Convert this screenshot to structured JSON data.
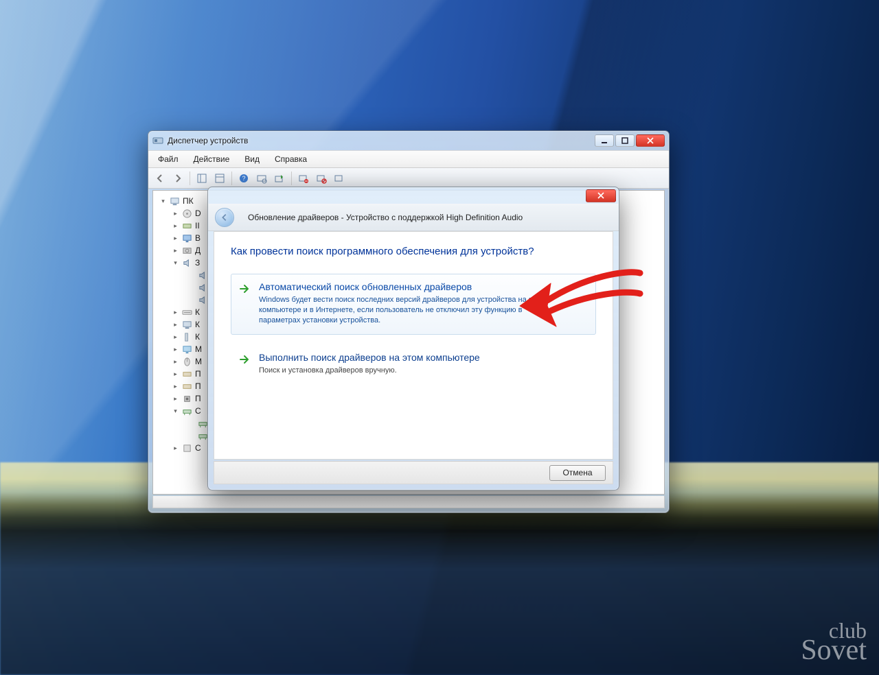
{
  "watermark": {
    "line1": "club",
    "line2": "Sovet"
  },
  "devmgr": {
    "title": "Диспетчер устройств",
    "menu": {
      "file": "Файл",
      "action": "Действие",
      "view": "Вид",
      "help": "Справка"
    },
    "root": "ПК",
    "items": [
      {
        "label": "D",
        "kind": "dvd"
      },
      {
        "label": "II",
        "kind": "ide"
      },
      {
        "label": "В",
        "kind": "display"
      },
      {
        "label": "Д",
        "kind": "disk"
      },
      {
        "label": "З",
        "kind": "sound",
        "expanded": true,
        "children": [
          {
            "label": ""
          },
          {
            "label": ""
          },
          {
            "label": ""
          }
        ]
      },
      {
        "label": "К",
        "kind": "keyboard"
      },
      {
        "label": "К",
        "kind": "pc"
      },
      {
        "label": "К",
        "kind": "usb"
      },
      {
        "label": "М",
        "kind": "monitor"
      },
      {
        "label": "М",
        "kind": "mouse"
      },
      {
        "label": "П",
        "kind": "port"
      },
      {
        "label": "П",
        "kind": "port"
      },
      {
        "label": "П",
        "kind": "cpu"
      },
      {
        "label": "С",
        "kind": "network",
        "expanded": true,
        "children": [
          {
            "label": ""
          },
          {
            "label": ""
          }
        ]
      },
      {
        "label": "С",
        "kind": "system"
      }
    ]
  },
  "dialog": {
    "header": "Обновление драйверов - Устройство с поддержкой High Definition Audio",
    "question": "Как провести поиск программного обеспечения для устройств?",
    "options": [
      {
        "title": "Автоматический поиск обновленных драйверов",
        "desc": "Windows будет вести поиск последних версий драйверов для устройства на этом компьютере и в Интернете, если пользователь не отключил эту функцию в параметрах установки устройства."
      },
      {
        "title": "Выполнить поиск драйверов на этом компьютере",
        "desc": "Поиск и установка драйверов вручную."
      }
    ],
    "cancel": "Отмена"
  }
}
